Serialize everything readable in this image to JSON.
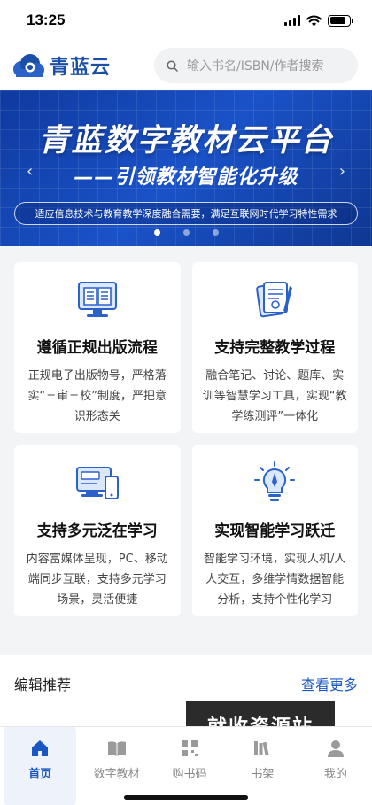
{
  "status_bar": {
    "time": "13:25"
  },
  "header": {
    "logo_text": "青蓝云",
    "search_placeholder": "输入书名/ISBN/作者搜索"
  },
  "banner": {
    "title": "青蓝数字教材云平台",
    "subtitle": "——引领教材智能化升级",
    "tagline": "适应信息技术与教育教学深度融合需要，满足互联网时代学习特性需求",
    "slide_count": 3,
    "active_slide": 1
  },
  "features": [
    {
      "icon": "book-monitor-icon",
      "title": "遵循正规出版流程",
      "desc": "正规电子出版物号，严格落实“三审三校”制度，严把意识形态关"
    },
    {
      "icon": "notebook-pen-icon",
      "title": "支持完整教学过程",
      "desc": "融合笔记、讨论、题库、实训等智慧学习工具，实现“教学练测评”一体化"
    },
    {
      "icon": "devices-icon",
      "title": "支持多元泛在学习",
      "desc": "内容富媒体呈现，PC、移动端同步互联，支持多元学习场景，灵活便捷"
    },
    {
      "icon": "lightbulb-icon",
      "title": "实现智能学习跃迁",
      "desc": "智能学习环境，实现人机/人人交互，多维学情数据智能分析，支持个性化学习"
    }
  ],
  "recommend": {
    "title": "编辑推荐",
    "more": "查看更多"
  },
  "watermark": "就收资源站",
  "tabbar": [
    {
      "icon": "home-icon",
      "label": "首页",
      "active": true
    },
    {
      "icon": "book-icon",
      "label": "数字教材",
      "active": false
    },
    {
      "icon": "code-icon",
      "label": "购书码",
      "active": false
    },
    {
      "icon": "shelf-icon",
      "label": "书架",
      "active": false
    },
    {
      "icon": "user-icon",
      "label": "我的",
      "active": false
    }
  ],
  "colors": {
    "brand": "#1a57c0",
    "banner": "#0f3a9e",
    "background": "#f3f4f6"
  }
}
